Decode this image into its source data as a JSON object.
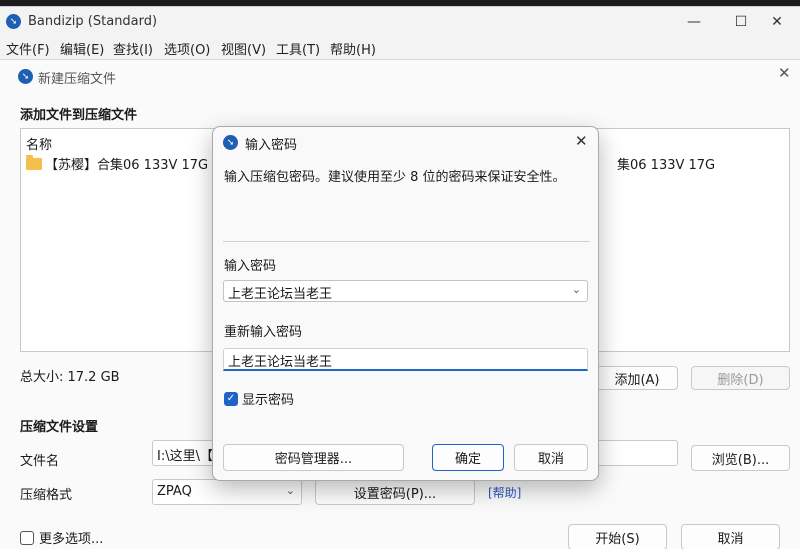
{
  "app": {
    "title": "Bandizip (Standard)",
    "minimize": "—",
    "maximize": "☐",
    "close": "✕"
  },
  "menu": [
    "文件(F)",
    "编辑(E)",
    "查找(I)",
    "选项(O)",
    "视图(V)",
    "工具(T)",
    "帮助(H)"
  ],
  "archive_dialog": {
    "title": "新建压缩文件",
    "add_section": "添加文件到压缩文件",
    "list_header": "名称",
    "files": [
      "【苏樱】合集06 133V 17G"
    ],
    "file_dup_fragment": "集06 133V 17G",
    "total_size": "总大小: 17.2 GB",
    "add_button": "添加(A)",
    "delete_button": "删除(D)",
    "settings_section": "压缩文件设置",
    "filename_label": "文件名",
    "filename_value": "I:\\这里\\【",
    "browse_button": "浏览(B)...",
    "format_label": "压缩格式",
    "format_value": "ZPAQ",
    "set_password_button": "设置密码(P)...",
    "help_link": "[帮助]",
    "more_options": "更多选项...",
    "start_button": "开始(S)",
    "cancel_button": "取消"
  },
  "password_dialog": {
    "title": "输入密码",
    "description": "输入压缩包密码。建议使用至少 8 位的密码来保证安全性。",
    "enter_label": "输入密码",
    "enter_value": "上老王论坛当老王",
    "reenter_label": "重新输入密码",
    "reenter_value": "上老王论坛当老王",
    "show_password": "显示密码",
    "show_password_checked": true,
    "manager_button": "密码管理器...",
    "ok_button": "确定",
    "cancel_button": "取消"
  },
  "colors": {
    "accent": "#1e64c8",
    "link": "#2a58c6"
  }
}
